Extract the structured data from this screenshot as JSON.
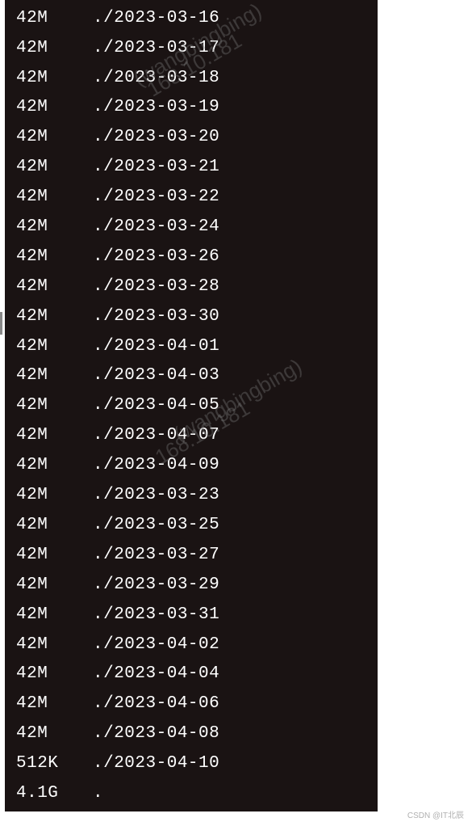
{
  "terminal": {
    "rows": [
      {
        "size": "42M",
        "path": "./2023-03-16"
      },
      {
        "size": "42M",
        "path": "./2023-03-17"
      },
      {
        "size": "42M",
        "path": "./2023-03-18"
      },
      {
        "size": "42M",
        "path": "./2023-03-19"
      },
      {
        "size": "42M",
        "path": "./2023-03-20"
      },
      {
        "size": "42M",
        "path": "./2023-03-21"
      },
      {
        "size": "42M",
        "path": "./2023-03-22"
      },
      {
        "size": "42M",
        "path": "./2023-03-24"
      },
      {
        "size": "42M",
        "path": "./2023-03-26"
      },
      {
        "size": "42M",
        "path": "./2023-03-28"
      },
      {
        "size": "42M",
        "path": "./2023-03-30"
      },
      {
        "size": "42M",
        "path": "./2023-04-01"
      },
      {
        "size": "42M",
        "path": "./2023-04-03"
      },
      {
        "size": "42M",
        "path": "./2023-04-05"
      },
      {
        "size": "42M",
        "path": "./2023-04-07"
      },
      {
        "size": "42M",
        "path": "./2023-04-09"
      },
      {
        "size": "42M",
        "path": "./2023-03-23"
      },
      {
        "size": "42M",
        "path": "./2023-03-25"
      },
      {
        "size": "42M",
        "path": "./2023-03-27"
      },
      {
        "size": "42M",
        "path": "./2023-03-29"
      },
      {
        "size": "42M",
        "path": "./2023-03-31"
      },
      {
        "size": "42M",
        "path": "./2023-04-02"
      },
      {
        "size": "42M",
        "path": "./2023-04-04"
      },
      {
        "size": "42M",
        "path": "./2023-04-06"
      },
      {
        "size": "42M",
        "path": "./2023-04-08"
      },
      {
        "size": "512K",
        "path": "./2023-04-10"
      },
      {
        "size": "4.1G",
        "path": "."
      }
    ]
  },
  "watermarks": {
    "wm1": "(wangbingbing)",
    "wm1b": "168.10.181",
    "wm2": "(wangbingbing)",
    "wm2b": "168.10.181"
  },
  "footer": "CSDN @IT北辰"
}
